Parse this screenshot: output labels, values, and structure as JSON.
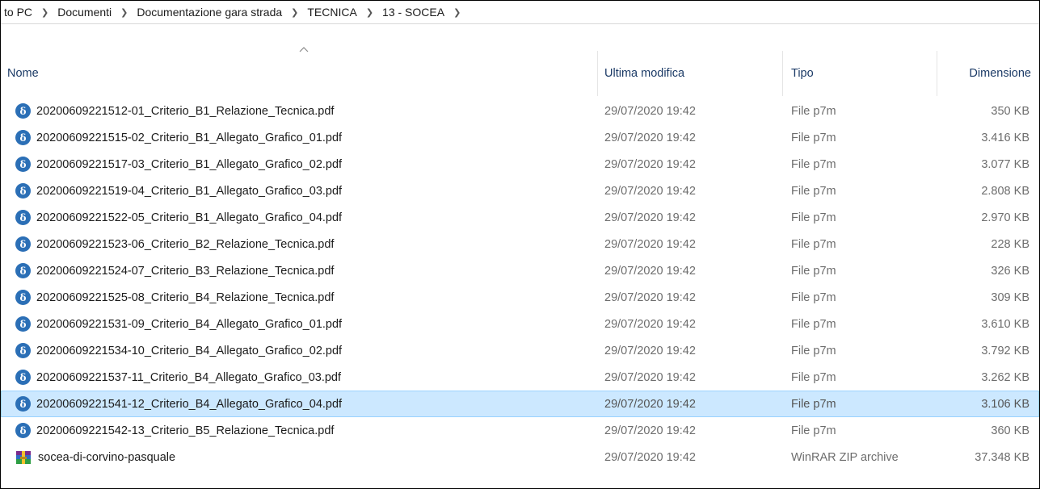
{
  "breadcrumb": [
    "to PC",
    "Documenti",
    "Documentazione gara strada",
    "TECNICA",
    "13 - SOCEA"
  ],
  "columns": {
    "name": "Nome",
    "modified": "Ultima modifica",
    "type": "Tipo",
    "size": "Dimensione"
  },
  "icons": {
    "sort": "chevron-up-icon",
    "p7m": "p7m-file-icon",
    "zip": "winrar-archive-icon",
    "separator": "chevron-right-icon"
  },
  "colors": {
    "selection": "#cce8ff",
    "header_text": "#1b3a66",
    "p7m_icon": "#2b6fb6"
  },
  "files": [
    {
      "name": "20200609221512-01_Criterio_B1_Relazione_Tecnica.pdf",
      "modified": "29/07/2020 19:42",
      "type": "File p7m",
      "size": "350 KB"
    },
    {
      "name": "20200609221515-02_Criterio_B1_Allegato_Grafico_01.pdf",
      "modified": "29/07/2020 19:42",
      "type": "File p7m",
      "size": "3.416 KB"
    },
    {
      "name": "20200609221517-03_Criterio_B1_Allegato_Grafico_02.pdf",
      "modified": "29/07/2020 19:42",
      "type": "File p7m",
      "size": "3.077 KB"
    },
    {
      "name": "20200609221519-04_Criterio_B1_Allegato_Grafico_03.pdf",
      "modified": "29/07/2020 19:42",
      "type": "File p7m",
      "size": "2.808 KB"
    },
    {
      "name": "20200609221522-05_Criterio_B1_Allegato_Grafico_04.pdf",
      "modified": "29/07/2020 19:42",
      "type": "File p7m",
      "size": "2.970 KB"
    },
    {
      "name": "20200609221523-06_Criterio_B2_Relazione_Tecnica.pdf",
      "modified": "29/07/2020 19:42",
      "type": "File p7m",
      "size": "228 KB"
    },
    {
      "name": "20200609221524-07_Criterio_B3_Relazione_Tecnica.pdf",
      "modified": "29/07/2020 19:42",
      "type": "File p7m",
      "size": "326 KB"
    },
    {
      "name": "20200609221525-08_Criterio_B4_Relazione_Tecnica.pdf",
      "modified": "29/07/2020 19:42",
      "type": "File p7m",
      "size": "309 KB"
    },
    {
      "name": "20200609221531-09_Criterio_B4_Allegato_Grafico_01.pdf",
      "modified": "29/07/2020 19:42",
      "type": "File p7m",
      "size": "3.610 KB"
    },
    {
      "name": "20200609221534-10_Criterio_B4_Allegato_Grafico_02.pdf",
      "modified": "29/07/2020 19:42",
      "type": "File p7m",
      "size": "3.792 KB"
    },
    {
      "name": "20200609221537-11_Criterio_B4_Allegato_Grafico_03.pdf",
      "modified": "29/07/2020 19:42",
      "type": "File p7m",
      "size": "3.262 KB"
    },
    {
      "name": "20200609221541-12_Criterio_B4_Allegato_Grafico_04.pdf",
      "modified": "29/07/2020 19:42",
      "type": "File p7m",
      "size": "3.106 KB",
      "selected": true
    },
    {
      "name": "20200609221542-13_Criterio_B5_Relazione_Tecnica.pdf",
      "modified": "29/07/2020 19:42",
      "type": "File p7m",
      "size": "360 KB"
    },
    {
      "name": "socea-di-corvino-pasquale",
      "modified": "29/07/2020 19:42",
      "type": "WinRAR ZIP archive",
      "size": "37.348 KB",
      "icon": "zip"
    }
  ]
}
